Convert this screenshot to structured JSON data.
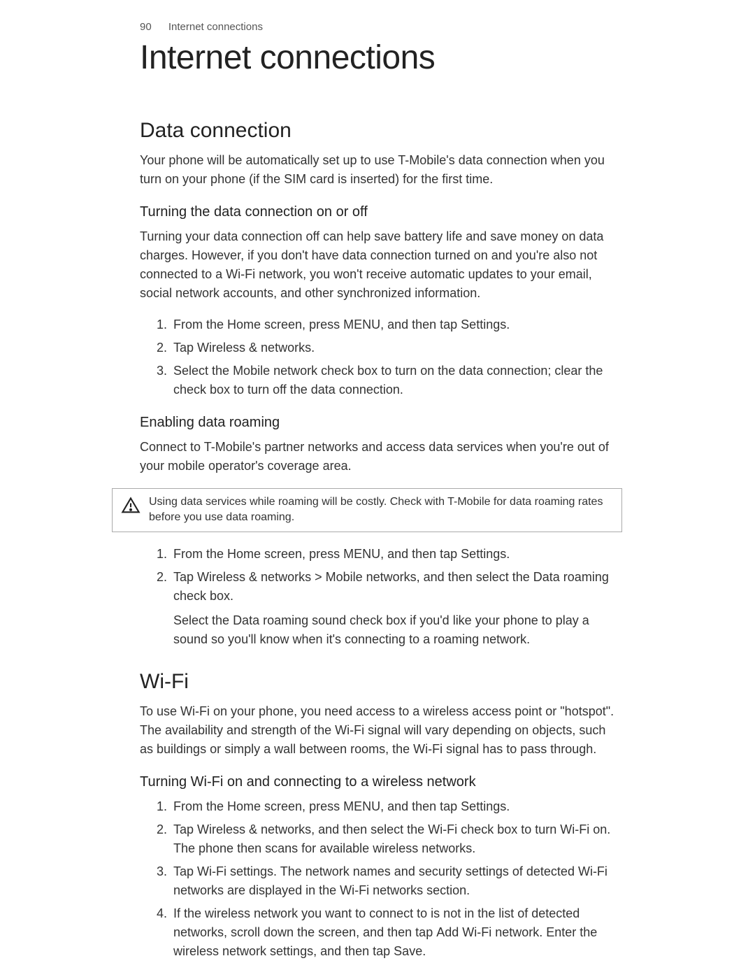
{
  "header": {
    "page_number": "90",
    "breadcrumb": "Internet connections"
  },
  "chapter_title": "Internet connections",
  "section1": {
    "title": "Data connection",
    "intro": "Your phone will be automatically set up to use T-Mobile's data connection when you turn on your phone (if the SIM card is inserted) for the first time.",
    "sub1": {
      "title": "Turning the data connection on or off",
      "intro": "Turning your data connection off can help save battery life and save money on data charges. However, if you don't have data connection turned on and you're also not connected to a Wi-Fi network, you won't receive automatic updates to your email, social network accounts, and other synchronized information.",
      "step1_prefix": "From the Home screen, press MENU, and then tap ",
      "step1_bold": "Settings",
      "step1_suffix": ".",
      "step2_prefix": "Tap ",
      "step2_bold": "Wireless & networks",
      "step2_suffix": ".",
      "step3_prefix": "Select the ",
      "step3_bold": "Mobile network",
      "step3_suffix": " check box to turn on the data connection; clear the check box to turn off the data connection."
    },
    "sub2": {
      "title": "Enabling data roaming",
      "intro": "Connect to T-Mobile's partner networks and access data services when you're out of your mobile operator's coverage area.",
      "warning": "Using data services while roaming will be costly. Check with T-Mobile for data roaming rates before you use data roaming.",
      "step1_prefix": "From the Home screen, press MENU, and then tap ",
      "step1_bold": "Settings",
      "step1_suffix": ".",
      "step2_prefix": "Tap ",
      "step2_bold1": "Wireless & networks",
      "step2_mid": " > ",
      "step2_bold2": "Mobile networks",
      "step2_mid2": ", and then select the ",
      "step2_bold3": "Data roaming",
      "step2_suffix": " check box.",
      "step2_sub_prefix": "Select the ",
      "step2_sub_bold": "Data roaming sound",
      "step2_sub_suffix": " check box if you'd like your phone to play a sound so you'll know when it's connecting to a roaming network."
    }
  },
  "section2": {
    "title": "Wi-Fi",
    "intro": "To use Wi-Fi on your phone, you need access to a wireless access point or \"hotspot\". The availability and strength of the Wi-Fi signal will vary depending on objects, such as buildings or simply a wall between rooms, the Wi-Fi signal has to pass through.",
    "sub1": {
      "title": "Turning Wi-Fi on and connecting to a wireless network",
      "step1_prefix": "From the Home screen, press MENU, and then tap ",
      "step1_bold": "Settings",
      "step1_suffix": ".",
      "step2_prefix": "Tap ",
      "step2_bold1": "Wireless & networks",
      "step2_mid": ", and then select the ",
      "step2_bold2": "Wi-Fi",
      "step2_suffix": " check box to turn Wi-Fi on. The phone then scans for available wireless networks.",
      "step3_prefix": "Tap ",
      "step3_bold": "Wi-Fi settings",
      "step3_suffix": ". The network names and security settings of detected Wi-Fi networks are displayed in the Wi-Fi networks section.",
      "step4_prefix": "If the wireless network you want to connect to is not in the list of detected networks, scroll down the screen, and then tap ",
      "step4_bold1": "Add Wi-Fi networ",
      "step4_mid": "k. Enter the wireless network settings, and then tap ",
      "step4_bold2": "Save",
      "step4_suffix": "."
    }
  }
}
